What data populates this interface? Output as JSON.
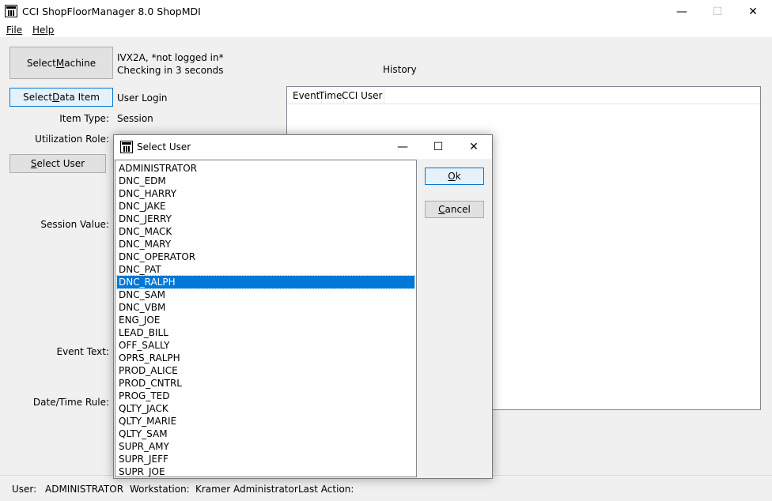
{
  "window": {
    "title": "CCI ShopFloorManager 8.0 ShopMDI",
    "min_glyph": "—",
    "max_glyph": "☐",
    "close_glyph": "✕"
  },
  "menu": {
    "file": "File",
    "help": "Help"
  },
  "main": {
    "select_machine_pre": "Select ",
    "select_machine_u": "M",
    "select_machine_post": "achine",
    "machine_status": "IVX2A, *not logged in*",
    "checking_text": "Checking in 3 seconds",
    "history_label": "History",
    "select_data_item_pre": "Select ",
    "select_data_item_u": "D",
    "select_data_item_post": "ata Item",
    "data_item_value": "User Login",
    "item_type_label": "Item Type:",
    "item_type_value": "Session",
    "utilization_role_label": "Utilization Role:",
    "select_user_pre": "",
    "select_user_u": "S",
    "select_user_post": "elect User",
    "session_value_label": "Session Value:",
    "event_text_label": "Event Text:",
    "date_time_rule_label": "Date/Time Rule:"
  },
  "history": {
    "columns": [
      "Event",
      "Time",
      "CCI User"
    ]
  },
  "status": {
    "user_label": "User:",
    "user_value": "ADMINISTRATOR",
    "workstation_label": "Workstation:",
    "workstation_value": "Kramer Administrator",
    "last_action_label": "Last Action:"
  },
  "dialog": {
    "title": "Select User",
    "ok_u": "O",
    "ok_post": "k",
    "cancel_u": "C",
    "cancel_post": "ancel",
    "min_glyph": "—",
    "max_glyph": "☐",
    "close_glyph": "✕",
    "selected_index": 9,
    "users": [
      "ADMINISTRATOR",
      "DNC_EDM",
      "DNC_HARRY",
      "DNC_JAKE",
      "DNC_JERRY",
      "DNC_MACK",
      "DNC_MARY",
      "DNC_OPERATOR",
      "DNC_PAT",
      "DNC_RALPH",
      "DNC_SAM",
      "DNC_VBM",
      "ENG_JOE",
      "LEAD_BILL",
      "OFF_SALLY",
      "OPRS_RALPH",
      "PROD_ALICE",
      "PROD_CNTRL",
      "PROG_TED",
      "QLTY_JACK",
      "QLTY_MARIE",
      "QLTY_SAM",
      "SUPR_AMY",
      "SUPR_JEFF",
      "SUPR_JOE"
    ]
  },
  "colors": {
    "selection": "#0078d7",
    "focus_border": "#0078d7"
  }
}
